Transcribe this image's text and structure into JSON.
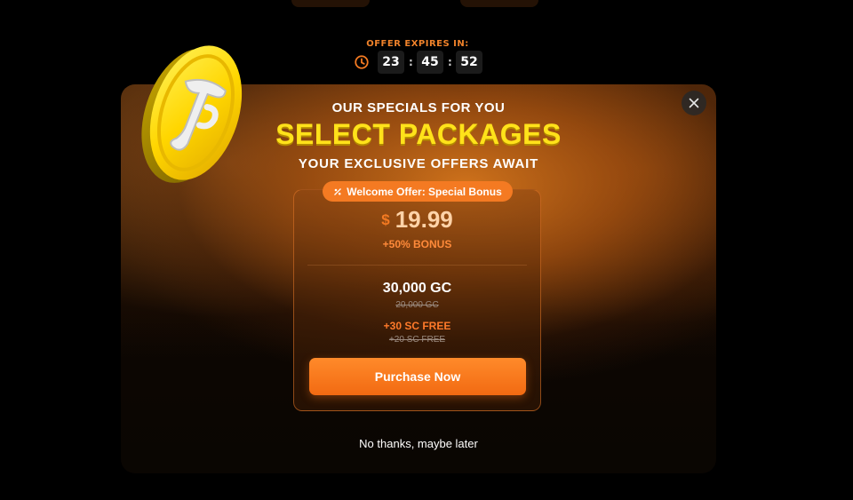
{
  "timer": {
    "label": "OFFER EXPIRES IN:",
    "hours": "23",
    "minutes": "45",
    "seconds": "52",
    "separator": ":",
    "icon": "clock-icon"
  },
  "modal": {
    "close_icon": "close-icon",
    "logo": "t-coin-logo",
    "heading_top": "OUR SPECIALS FOR YOU",
    "title": "SELECT PACKAGES",
    "subtitle": "YOUR EXCLUSIVE OFFERS AWAIT",
    "card": {
      "badge_icon": "sparkle-icon",
      "badge_label": "Welcome Offer: Special Bonus",
      "currency": "$",
      "price": "19.99",
      "bonus": "+50% BONUS",
      "gc_amount": "30,000 GC",
      "gc_old": "20,000 GC",
      "sc_amount": "+30 SC FREE",
      "sc_old": "+20 SC FREE",
      "purchase_label": "Purchase Now"
    },
    "dismiss_label": "No thanks, maybe later"
  },
  "colors": {
    "accent": "#f47a22",
    "title_yellow": "#ffe21a",
    "background": "#000000"
  }
}
